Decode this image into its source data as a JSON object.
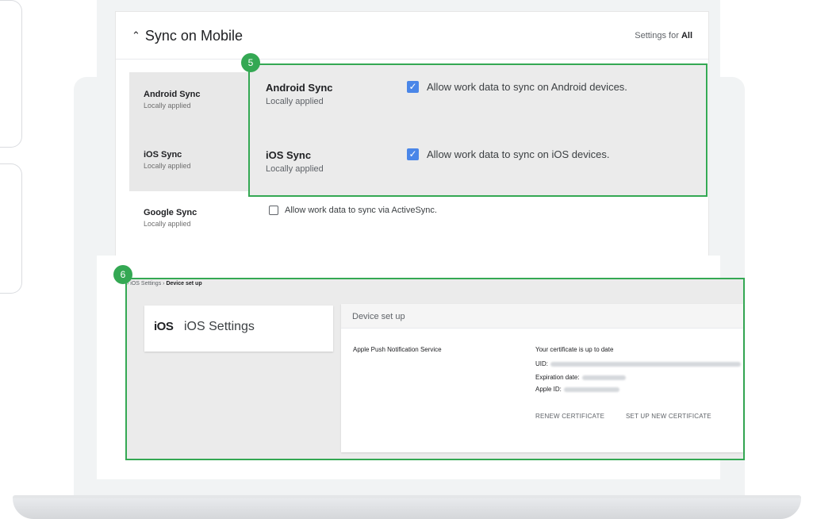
{
  "sync": {
    "title": "Sync on Mobile",
    "settings_for_prefix": "Settings for",
    "settings_for_value": "All",
    "rows": [
      {
        "label": "Android Sync",
        "sub": "Locally applied"
      },
      {
        "label": "iOS Sync",
        "sub": "Locally applied"
      },
      {
        "label": "Google Sync",
        "sub": "Locally applied",
        "checkbox": "Allow work data to sync via ActiveSync.",
        "checked": false
      }
    ]
  },
  "callout5": {
    "badge": "5",
    "items": [
      {
        "label": "Android Sync",
        "sub": "Locally applied",
        "checkbox": "Allow work data to sync on Android devices.",
        "checked": true
      },
      {
        "label": "iOS Sync",
        "sub": "Locally applied",
        "checkbox": "Allow work data to sync on iOS devices.",
        "checked": true
      }
    ]
  },
  "callout6": {
    "badge": "6",
    "breadcrumb": {
      "crumb1": "iOS Settings",
      "current": "Device set up"
    },
    "ios_card": {
      "logo": "iOS",
      "title": "iOS Settings"
    },
    "device": {
      "header": "Device set up",
      "service": "Apple Push Notification Service",
      "status": "Your certificate is up to date",
      "uid_label": "UID:",
      "expiration_label": "Expiration date:",
      "apple_id_label": "Apple ID:",
      "renew": "RENEW CERTIFICATE",
      "setup_new": "SET UP NEW CERTIFICATE"
    }
  },
  "colors": {
    "accent_green": "#34a853",
    "checkbox_blue": "#4a86e8"
  }
}
